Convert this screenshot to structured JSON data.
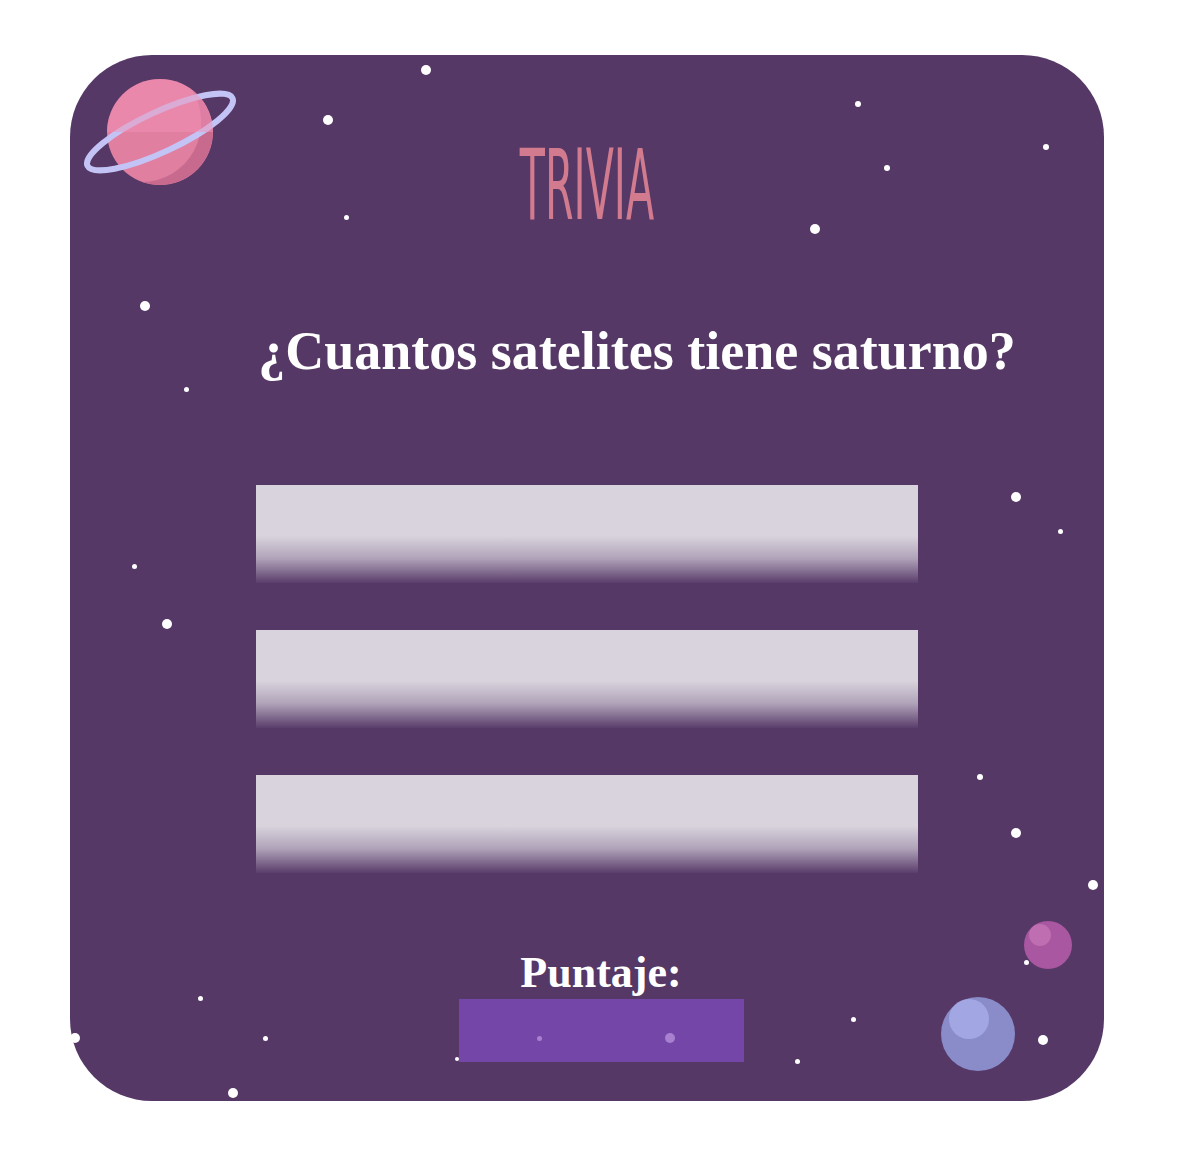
{
  "title": "TRIVIA",
  "question": "¿Cuantos satelites tiene saturno?",
  "answers": [
    {
      "text": ""
    },
    {
      "text": ""
    },
    {
      "text": ""
    }
  ],
  "score": {
    "label": "Puntaje:",
    "value": ""
  }
}
